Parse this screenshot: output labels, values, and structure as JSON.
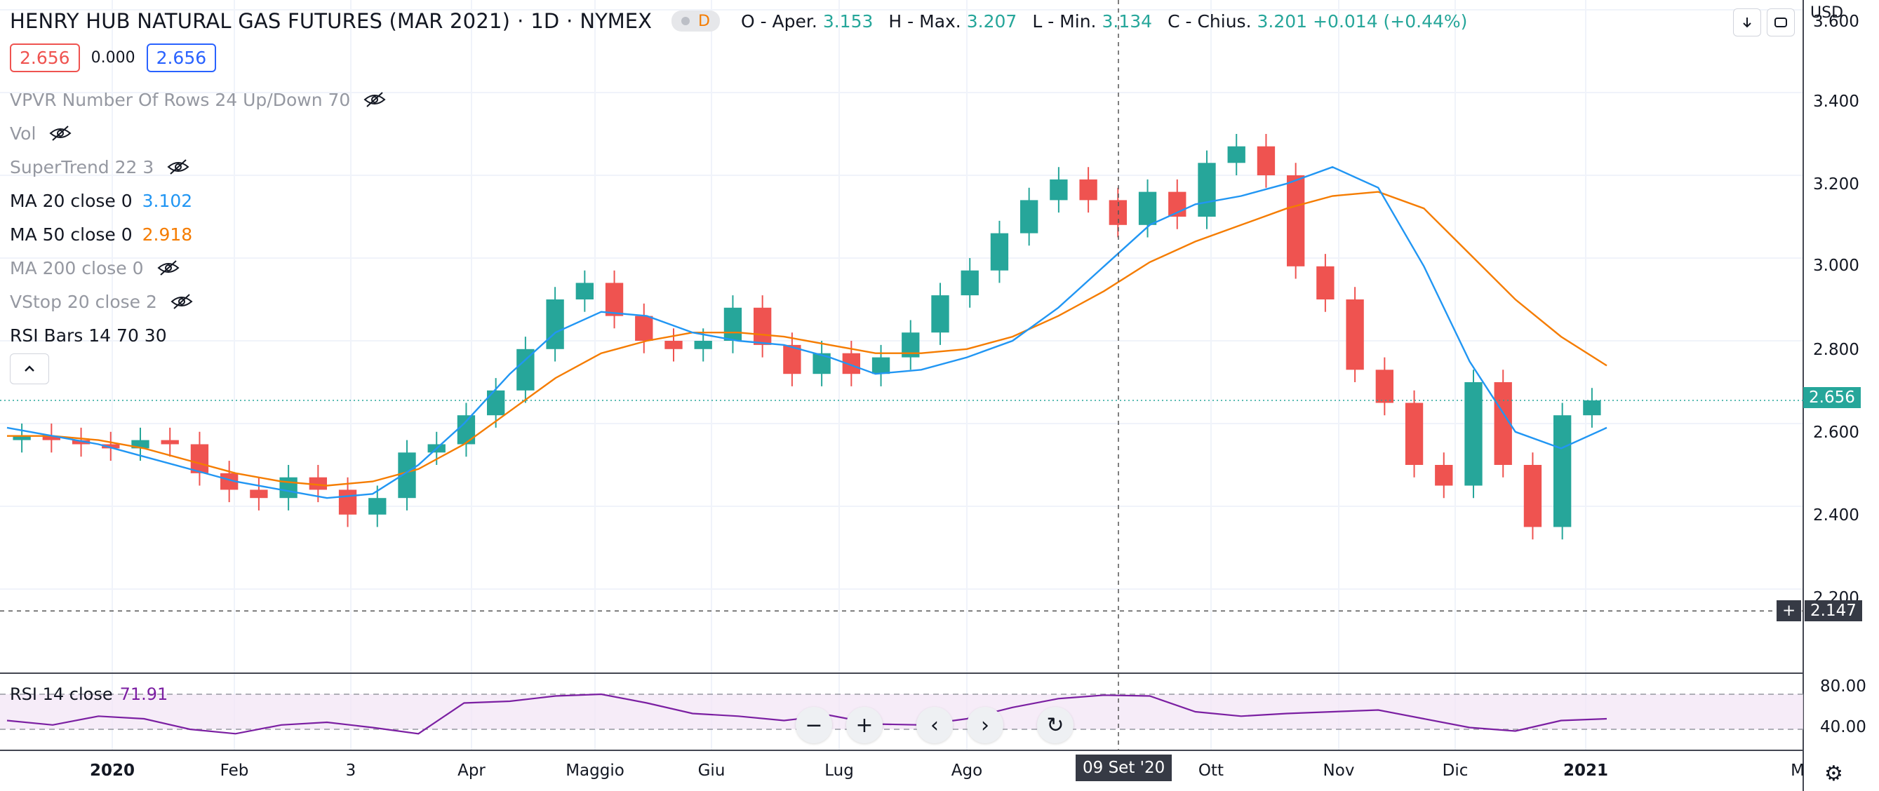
{
  "header": {
    "title": "HENRY HUB NATURAL GAS FUTURES (MAR 2021)",
    "interval": "1D",
    "exchange": "NYMEX",
    "badge_letter": "D",
    "ohlc": {
      "o_label": "O - Aper.",
      "o_value": "3.153",
      "h_label": "H - Max.",
      "h_value": "3.207",
      "l_label": "L - Min.",
      "l_value": "3.134",
      "c_label": "C - Chius.",
      "c_value": "3.201",
      "change": "+0.014 (+0.44%)"
    },
    "buttons": {
      "download_icon": "arrow-down-icon",
      "fullscreen_icon": "fullscreen-icon"
    }
  },
  "price_boxes": {
    "bid": "2.656",
    "spread": "0.000",
    "ask": "2.656"
  },
  "indicators": [
    {
      "label": "VPVR Number Of Rows 24 Up/Down 70",
      "value": "",
      "hidden": true
    },
    {
      "label": "Vol",
      "value": "",
      "hidden": true
    },
    {
      "label": "SuperTrend 22 3",
      "value": "",
      "hidden": true
    },
    {
      "label": "MA 20 close 0",
      "value": "3.102",
      "hidden": false,
      "color": "#2196f3"
    },
    {
      "label": "MA 50 close 0",
      "value": "2.918",
      "hidden": false,
      "color": "#f57c00"
    },
    {
      "label": "MA 200 close 0",
      "value": "",
      "hidden": true
    },
    {
      "label": "VStop 20 close 2",
      "value": "",
      "hidden": true
    },
    {
      "label": "RSI Bars 14 70 30",
      "value": "",
      "hidden": false
    }
  ],
  "rsi": {
    "label": "RSI 14 close",
    "value": "71.91",
    "color": "#7b1fa2",
    "upper": "80.00",
    "lower": "40.00"
  },
  "price_axis": {
    "currency": "USD",
    "ticks": [
      "3.600",
      "3.400",
      "3.200",
      "3.000",
      "2.800",
      "2.600",
      "2.400",
      "2.200"
    ],
    "last_price": "2.656",
    "crosshair_price": "2.147"
  },
  "time_axis": {
    "labels": [
      {
        "text": "2020",
        "bold": true
      },
      {
        "text": "Feb",
        "bold": false
      },
      {
        "text": "3",
        "bold": false
      },
      {
        "text": "Apr",
        "bold": false
      },
      {
        "text": "Maggio",
        "bold": false
      },
      {
        "text": "Giu",
        "bold": false
      },
      {
        "text": "Lug",
        "bold": false
      },
      {
        "text": "Ago",
        "bold": false
      },
      {
        "text": "Ott",
        "bold": false
      },
      {
        "text": "Nov",
        "bold": false
      },
      {
        "text": "Dic",
        "bold": false
      },
      {
        "text": "2021",
        "bold": true
      },
      {
        "text": "M",
        "bold": false
      }
    ],
    "crosshair_date": "09 Set '20"
  },
  "nav_buttons": [
    "zoom-out-icon",
    "zoom-in-icon",
    "scroll-left-icon",
    "scroll-right-icon",
    "reset-icon"
  ],
  "colors": {
    "up": "#26a69a",
    "down": "#ef5350",
    "ma20": "#2196f3",
    "ma50": "#f57c00",
    "rsi": "#7b1fa2",
    "axis_tag": "#26a69a",
    "crosshair_tag": "#363a45"
  },
  "chart_data": {
    "type": "candlestick",
    "title": "HENRY HUB NATURAL GAS FUTURES (MAR 2021)",
    "ylim": [
      2.1,
      3.65
    ],
    "series": [
      {
        "name": "MA 20 close 0",
        "values": [
          2.59,
          2.57,
          2.55,
          2.52,
          2.49,
          2.46,
          2.44,
          2.42,
          2.43,
          2.5,
          2.6,
          2.72,
          2.82,
          2.87,
          2.86,
          2.82,
          2.8,
          2.79,
          2.76,
          2.72,
          2.73,
          2.76,
          2.8,
          2.88,
          2.98,
          3.08,
          3.13,
          3.15,
          3.18,
          3.22,
          3.17,
          2.98,
          2.75,
          2.58,
          2.54,
          2.59
        ]
      },
      {
        "name": "MA 50 close 0",
        "values": [
          2.57,
          2.57,
          2.56,
          2.54,
          2.51,
          2.48,
          2.46,
          2.45,
          2.46,
          2.49,
          2.55,
          2.63,
          2.71,
          2.77,
          2.8,
          2.82,
          2.82,
          2.81,
          2.79,
          2.77,
          2.77,
          2.78,
          2.81,
          2.86,
          2.92,
          2.99,
          3.04,
          3.08,
          3.12,
          3.15,
          3.16,
          3.12,
          3.01,
          2.9,
          2.81,
          2.74
        ]
      },
      {
        "name": "RSI 14 close",
        "values": [
          50,
          45,
          55,
          52,
          40,
          35,
          45,
          48,
          42,
          35,
          70,
          72,
          78,
          80,
          70,
          58,
          55,
          50,
          56,
          46,
          45,
          52,
          65,
          75,
          79,
          78,
          60,
          55,
          58,
          60,
          62,
          52,
          42,
          38,
          50,
          52
        ]
      }
    ],
    "candles": {
      "close": [
        2.57,
        2.56,
        2.55,
        2.54,
        2.56,
        2.55,
        2.48,
        2.44,
        2.42,
        2.47,
        2.44,
        2.38,
        2.42,
        2.53,
        2.55,
        2.62,
        2.68,
        2.78,
        2.9,
        2.94,
        2.86,
        2.8,
        2.78,
        2.8,
        2.88,
        2.79,
        2.72,
        2.77,
        2.72,
        2.76,
        2.82,
        2.91,
        2.97,
        3.06,
        3.14,
        3.19,
        3.14,
        3.08,
        3.16,
        3.1,
        3.23,
        3.27,
        3.2,
        2.98,
        2.9,
        2.73,
        2.65,
        2.5,
        2.45,
        2.7,
        2.5,
        2.35,
        2.62,
        2.656
      ]
    }
  }
}
